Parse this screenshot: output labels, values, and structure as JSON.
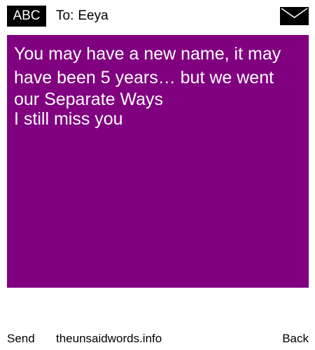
{
  "header": {
    "badge_label": "ABC",
    "to_prefix": "To:",
    "recipient": "Eeya",
    "icon": "envelope-icon"
  },
  "message": {
    "background_color": "#800080",
    "text_color": "#ffffff",
    "lines": [
      "You may have a new name, it may",
      "have been 5 years… but we went",
      "our Separate Ways",
      "I still miss you"
    ]
  },
  "footer": {
    "send_label": "Send",
    "site_label": "theunsaidwords.info",
    "back_label": "Back"
  }
}
